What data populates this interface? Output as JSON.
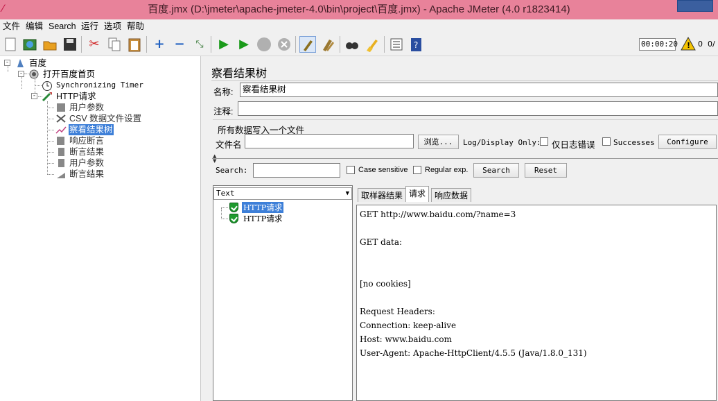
{
  "window": {
    "title": "百度.jmx (D:\\jmeter\\apache-jmeter-4.0\\bin\\project\\百度.jmx) - Apache JMeter (4.0 r1823414)",
    "accent": "#e8829a"
  },
  "menu": [
    "文件",
    "编辑",
    "Search",
    "运行",
    "选项",
    "帮助"
  ],
  "toolbar": {
    "icons": [
      "new-icon",
      "templates-icon",
      "open-icon",
      "save-icon",
      "cut-icon",
      "copy-icon",
      "paste-icon",
      "expand-icon",
      "collapse-icon",
      "toggle-icon",
      "start-icon",
      "start-no-pause-icon",
      "stop-icon",
      "shutdown-icon",
      "clear-icon",
      "clear-all-icon",
      "search-icon",
      "reset-search-icon",
      "function-helper-icon",
      "help-icon"
    ],
    "timer": "00:00:20",
    "warnings": "0",
    "threads": "0/"
  },
  "tree": [
    {
      "label": "百度",
      "icon": "test-plan-icon",
      "selected": false
    },
    {
      "label": "打开百度首页",
      "icon": "thread-group-icon",
      "selected": false
    },
    {
      "label": "Synchronizing Timer",
      "icon": "timer-icon",
      "selected": false
    },
    {
      "label": "HTTP请求",
      "icon": "http-sampler-icon",
      "selected": false
    },
    {
      "label": "用户参数",
      "icon": "preprocessor-icon",
      "selected": false
    },
    {
      "label": "CSV 数据文件设置",
      "icon": "csv-config-icon",
      "selected": false
    },
    {
      "label": "察看结果树",
      "icon": "listener-icon",
      "selected": true
    },
    {
      "label": "响应断言",
      "icon": "assertion-icon",
      "selected": false
    },
    {
      "label": "断言结果",
      "icon": "listener-icon",
      "selected": false
    },
    {
      "label": "用户参数",
      "icon": "preprocessor-icon",
      "selected": false
    },
    {
      "label": "断言结果",
      "icon": "listener-icon",
      "selected": false
    }
  ],
  "viewer": {
    "title": "察看结果树",
    "name_label": "名称:",
    "name_value": "察看结果树",
    "comment_label": "注释:",
    "comment_value": "",
    "file_section": "所有数据写入一个文件",
    "file_label": "文件名",
    "file_value": "",
    "browse": "浏览...",
    "log_display": "Log/Display Only:",
    "errors_only": "仅日志错误",
    "successes": "Successes",
    "configure": "Configure"
  },
  "search": {
    "label": "Search:",
    "value": "",
    "case_sensitive": "Case sensitive",
    "regex": "Regular exp.",
    "search_btn": "Search",
    "reset_btn": "Reset"
  },
  "results": {
    "renderer": "Text",
    "samples": [
      {
        "label": "HTTP请求",
        "selected": true
      },
      {
        "label": "HTTP请求",
        "selected": false
      }
    ]
  },
  "tabs": [
    {
      "label": "取样器结果",
      "active": false
    },
    {
      "label": "请求",
      "active": true
    },
    {
      "label": "响应数据",
      "active": false
    }
  ],
  "request_lines": [
    "GET http://www.baidu.com/?name=3",
    "",
    "GET data:",
    "",
    "",
    "[no cookies]",
    "",
    "Request Headers:",
    "Connection: keep-alive",
    "Host: www.baidu.com",
    "User-Agent: Apache-HttpClient/4.5.5 (Java/1.8.0_131)"
  ]
}
